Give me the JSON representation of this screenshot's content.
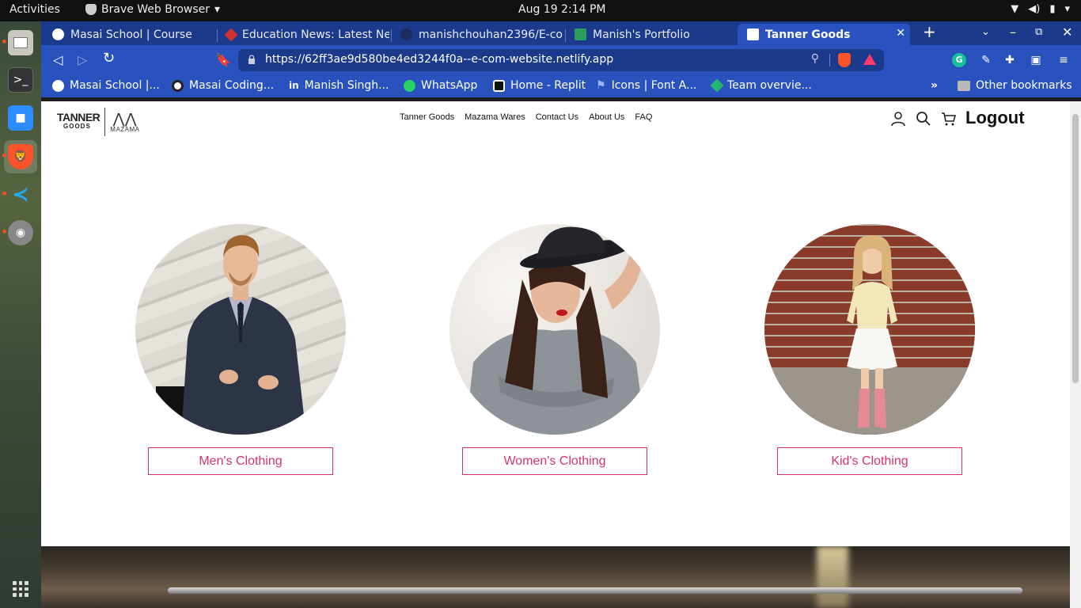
{
  "system": {
    "activities": "Activities",
    "app_menu": "Brave Web Browser",
    "clock": "Aug 19  2:14 PM"
  },
  "dock": {
    "items": [
      "files",
      "terminal",
      "zoom",
      "brave",
      "vscode",
      "disks"
    ]
  },
  "tabs": [
    {
      "title": "Masai School | Course",
      "active": false
    },
    {
      "title": "Education News: Latest Ne",
      "active": false
    },
    {
      "title": "manishchouhan2396/E-com",
      "active": false
    },
    {
      "title": "Manish's Portfolio",
      "active": false
    },
    {
      "title": "Tanner Goods",
      "active": true
    }
  ],
  "address_bar": {
    "url": "https://62ff3ae9d580be4ed3244f0a--e-com-website.netlify.app"
  },
  "bookmarks": [
    "Masai School |...",
    "Masai Coding...",
    "Manish Singh...",
    "WhatsApp",
    "Home - Replit",
    "Icons | Font A...",
    "Team overvie..."
  ],
  "bookmarks_other": "Other bookmarks",
  "site": {
    "logo_primary": "TANNER",
    "logo_sub": "GOODS",
    "logo_secondary": "MAZAMA",
    "nav": [
      "Tanner Goods",
      "Mazama Wares",
      "Contact Us",
      "About Us",
      "FAQ"
    ],
    "logout": "Logout",
    "categories": [
      {
        "label": "Men's Clothing"
      },
      {
        "label": "Women's Clothing"
      },
      {
        "label": "Kid's Clothing"
      }
    ]
  },
  "colors": {
    "accent_pink": "#d6336c",
    "browser_blue": "#2a52be",
    "tabstrip_blue": "#1c3a8c"
  }
}
